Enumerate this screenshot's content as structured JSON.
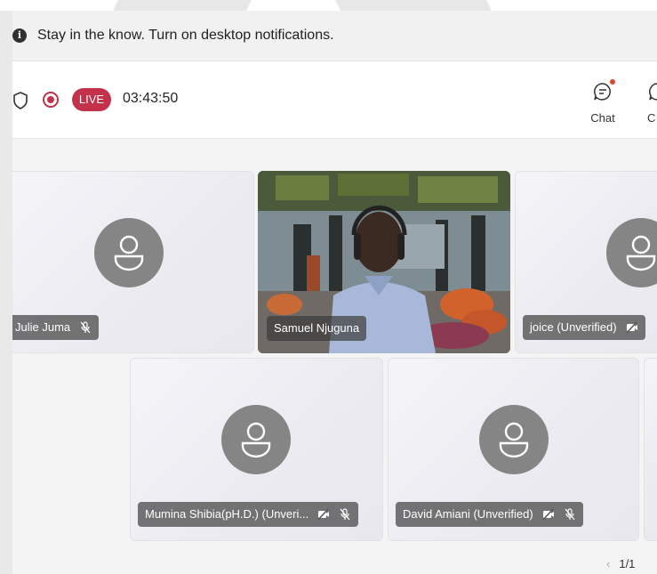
{
  "notification": {
    "text": "Stay in the know. Turn on desktop notifications."
  },
  "toolbar": {
    "live_label": "LIVE",
    "timer": "03:43:50",
    "chat_label": "Chat",
    "more_label": "C"
  },
  "participants": [
    {
      "name": "Julie Juma"
    },
    {
      "name": "Samuel Njuguna"
    },
    {
      "name": "joice (Unverified)"
    },
    {
      "name": "Mumina Shibia(pH.D.) (Unveri..."
    },
    {
      "name": "David Amiani (Unverified)"
    }
  ],
  "pager": {
    "label": "1/1"
  },
  "colors": {
    "live": "#c4314b",
    "chat_dot": "#d9472b",
    "avatar": "#858585"
  }
}
